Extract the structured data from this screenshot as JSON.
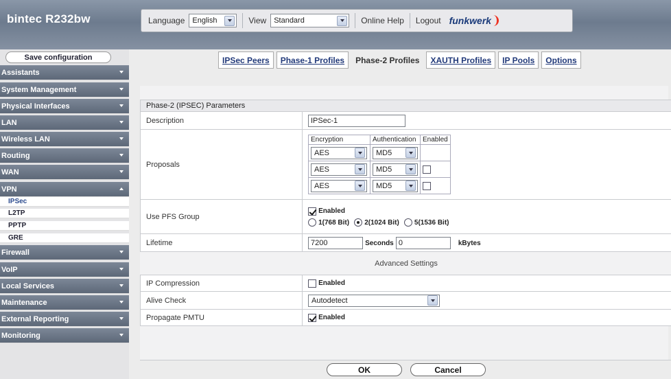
{
  "brand": "bintec R232bw",
  "toolbar": {
    "language_label": "Language",
    "language_value": "English",
    "view_label": "View",
    "view_value": "Standard",
    "online_help": "Online Help",
    "logout": "Logout",
    "logo": "funkwerk"
  },
  "sidebar": {
    "save": "Save configuration",
    "items": [
      {
        "label": "Assistants"
      },
      {
        "label": "System Management"
      },
      {
        "label": "Physical Interfaces"
      },
      {
        "label": "LAN"
      },
      {
        "label": "Wireless LAN"
      },
      {
        "label": "Routing"
      },
      {
        "label": "WAN"
      },
      {
        "label": "VPN"
      },
      {
        "label": "Firewall"
      },
      {
        "label": "VoIP"
      },
      {
        "label": "Local Services"
      },
      {
        "label": "Maintenance"
      },
      {
        "label": "External Reporting"
      },
      {
        "label": "Monitoring"
      }
    ],
    "vpn_sub": [
      {
        "label": "IPSec"
      },
      {
        "label": "L2TP"
      },
      {
        "label": "PPTP"
      },
      {
        "label": "GRE"
      }
    ]
  },
  "tabs": [
    {
      "label": "IPSec Peers"
    },
    {
      "label": "Phase-1 Profiles"
    },
    {
      "label": "Phase-2 Profiles"
    },
    {
      "label": "XAUTH Profiles"
    },
    {
      "label": "IP Pools"
    },
    {
      "label": "Options"
    }
  ],
  "form": {
    "section_title": "Phase-2 (IPSEC) Parameters",
    "description_label": "Description",
    "description_value": "IPSec-1",
    "proposals_label": "Proposals",
    "proposals_headers": {
      "encryption": "Encryption",
      "authentication": "Authentication",
      "enabled": "Enabled"
    },
    "proposals": [
      {
        "encryption": "AES",
        "authentication": "MD5",
        "enabled_box": false
      },
      {
        "encryption": "AES",
        "authentication": "MD5",
        "enabled_box": true,
        "checked": false
      },
      {
        "encryption": "AES",
        "authentication": "MD5",
        "enabled_box": true,
        "checked": false
      }
    ],
    "pfs_label": "Use PFS Group",
    "pfs_enabled_text": "Enabled",
    "pfs_options": [
      "1(768 Bit)",
      "2(1024 Bit)",
      "5(1536 Bit)"
    ],
    "lifetime_label": "Lifetime",
    "lifetime_seconds": "7200",
    "seconds_text": "Seconds",
    "lifetime_kbytes": "0",
    "kbytes_text": "kBytes",
    "advanced_title": "Advanced Settings",
    "ip_compression_label": "IP Compression",
    "ip_compression_text": "Enabled",
    "alive_check_label": "Alive Check",
    "alive_check_value": "Autodetect",
    "pmtu_label": "Propagate PMTU",
    "pmtu_text": "Enabled"
  },
  "buttons": {
    "ok": "OK",
    "cancel": "Cancel"
  }
}
